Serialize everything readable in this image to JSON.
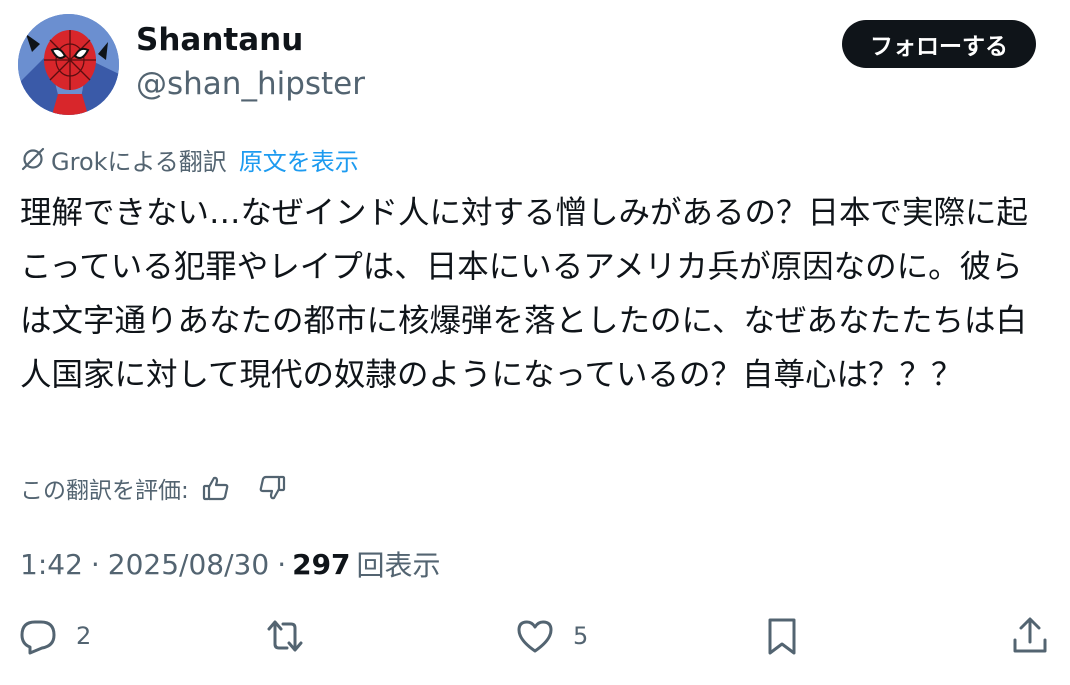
{
  "user": {
    "name": "Shantanu",
    "handle": "@shan_hipster",
    "avatar_icon": "spiderman-avatar"
  },
  "follow_button": {
    "label": "フォローする"
  },
  "translation": {
    "provider_label": "Grokによる翻訳",
    "show_original_label": "原文を表示"
  },
  "tweet": {
    "text": "理解できない…なぜインド人に対する憎しみがあるの？日本で実際に起こっている犯罪やレイプは、日本にいるアメリカ兵が原因なのに。彼らは文字通りあなたの都市に核爆弾を落としたのに、なぜあなたたちは白人国家に対して現代の奴隷のようになっているの？自尊心は？？？"
  },
  "rating": {
    "label": "この翻訳を評価:"
  },
  "meta": {
    "time": "1:42",
    "separator": "·",
    "date": "2025/08/30",
    "views_count": "297",
    "views_label": "回表示"
  },
  "actions": {
    "reply_count": "2",
    "retweet_count": "",
    "like_count": "5"
  },
  "colors": {
    "text": "#0f1419",
    "secondary": "#536471",
    "link": "#1d9bf0",
    "follow_bg": "#0f1419"
  }
}
